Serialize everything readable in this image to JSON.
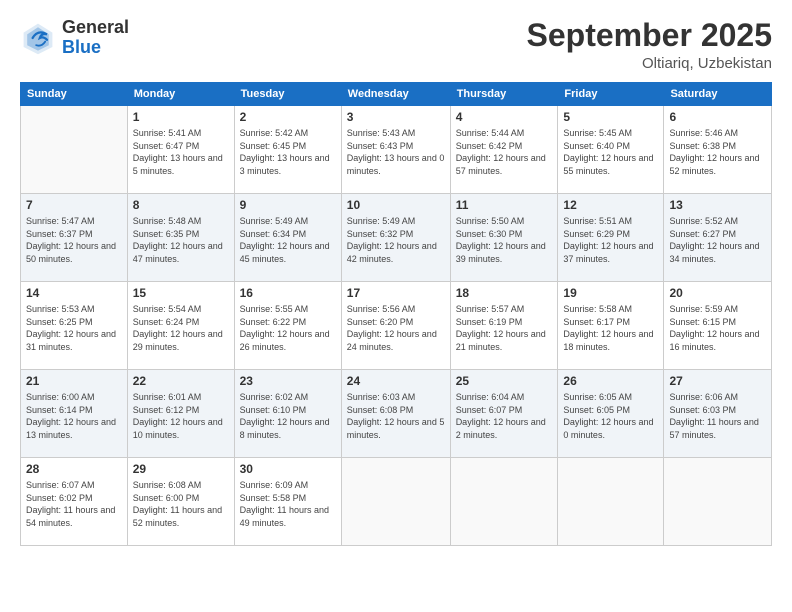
{
  "logo": {
    "general": "General",
    "blue": "Blue"
  },
  "header": {
    "month": "September 2025",
    "location": "Oltiariq, Uzbekistan"
  },
  "weekdays": [
    "Sunday",
    "Monday",
    "Tuesday",
    "Wednesday",
    "Thursday",
    "Friday",
    "Saturday"
  ],
  "weeks": [
    [
      {
        "day": "",
        "sunrise": "",
        "sunset": "",
        "daylight": ""
      },
      {
        "day": "1",
        "sunrise": "Sunrise: 5:41 AM",
        "sunset": "Sunset: 6:47 PM",
        "daylight": "Daylight: 13 hours and 5 minutes."
      },
      {
        "day": "2",
        "sunrise": "Sunrise: 5:42 AM",
        "sunset": "Sunset: 6:45 PM",
        "daylight": "Daylight: 13 hours and 3 minutes."
      },
      {
        "day": "3",
        "sunrise": "Sunrise: 5:43 AM",
        "sunset": "Sunset: 6:43 PM",
        "daylight": "Daylight: 13 hours and 0 minutes."
      },
      {
        "day": "4",
        "sunrise": "Sunrise: 5:44 AM",
        "sunset": "Sunset: 6:42 PM",
        "daylight": "Daylight: 12 hours and 57 minutes."
      },
      {
        "day": "5",
        "sunrise": "Sunrise: 5:45 AM",
        "sunset": "Sunset: 6:40 PM",
        "daylight": "Daylight: 12 hours and 55 minutes."
      },
      {
        "day": "6",
        "sunrise": "Sunrise: 5:46 AM",
        "sunset": "Sunset: 6:38 PM",
        "daylight": "Daylight: 12 hours and 52 minutes."
      }
    ],
    [
      {
        "day": "7",
        "sunrise": "Sunrise: 5:47 AM",
        "sunset": "Sunset: 6:37 PM",
        "daylight": "Daylight: 12 hours and 50 minutes."
      },
      {
        "day": "8",
        "sunrise": "Sunrise: 5:48 AM",
        "sunset": "Sunset: 6:35 PM",
        "daylight": "Daylight: 12 hours and 47 minutes."
      },
      {
        "day": "9",
        "sunrise": "Sunrise: 5:49 AM",
        "sunset": "Sunset: 6:34 PM",
        "daylight": "Daylight: 12 hours and 45 minutes."
      },
      {
        "day": "10",
        "sunrise": "Sunrise: 5:49 AM",
        "sunset": "Sunset: 6:32 PM",
        "daylight": "Daylight: 12 hours and 42 minutes."
      },
      {
        "day": "11",
        "sunrise": "Sunrise: 5:50 AM",
        "sunset": "Sunset: 6:30 PM",
        "daylight": "Daylight: 12 hours and 39 minutes."
      },
      {
        "day": "12",
        "sunrise": "Sunrise: 5:51 AM",
        "sunset": "Sunset: 6:29 PM",
        "daylight": "Daylight: 12 hours and 37 minutes."
      },
      {
        "day": "13",
        "sunrise": "Sunrise: 5:52 AM",
        "sunset": "Sunset: 6:27 PM",
        "daylight": "Daylight: 12 hours and 34 minutes."
      }
    ],
    [
      {
        "day": "14",
        "sunrise": "Sunrise: 5:53 AM",
        "sunset": "Sunset: 6:25 PM",
        "daylight": "Daylight: 12 hours and 31 minutes."
      },
      {
        "day": "15",
        "sunrise": "Sunrise: 5:54 AM",
        "sunset": "Sunset: 6:24 PM",
        "daylight": "Daylight: 12 hours and 29 minutes."
      },
      {
        "day": "16",
        "sunrise": "Sunrise: 5:55 AM",
        "sunset": "Sunset: 6:22 PM",
        "daylight": "Daylight: 12 hours and 26 minutes."
      },
      {
        "day": "17",
        "sunrise": "Sunrise: 5:56 AM",
        "sunset": "Sunset: 6:20 PM",
        "daylight": "Daylight: 12 hours and 24 minutes."
      },
      {
        "day": "18",
        "sunrise": "Sunrise: 5:57 AM",
        "sunset": "Sunset: 6:19 PM",
        "daylight": "Daylight: 12 hours and 21 minutes."
      },
      {
        "day": "19",
        "sunrise": "Sunrise: 5:58 AM",
        "sunset": "Sunset: 6:17 PM",
        "daylight": "Daylight: 12 hours and 18 minutes."
      },
      {
        "day": "20",
        "sunrise": "Sunrise: 5:59 AM",
        "sunset": "Sunset: 6:15 PM",
        "daylight": "Daylight: 12 hours and 16 minutes."
      }
    ],
    [
      {
        "day": "21",
        "sunrise": "Sunrise: 6:00 AM",
        "sunset": "Sunset: 6:14 PM",
        "daylight": "Daylight: 12 hours and 13 minutes."
      },
      {
        "day": "22",
        "sunrise": "Sunrise: 6:01 AM",
        "sunset": "Sunset: 6:12 PM",
        "daylight": "Daylight: 12 hours and 10 minutes."
      },
      {
        "day": "23",
        "sunrise": "Sunrise: 6:02 AM",
        "sunset": "Sunset: 6:10 PM",
        "daylight": "Daylight: 12 hours and 8 minutes."
      },
      {
        "day": "24",
        "sunrise": "Sunrise: 6:03 AM",
        "sunset": "Sunset: 6:08 PM",
        "daylight": "Daylight: 12 hours and 5 minutes."
      },
      {
        "day": "25",
        "sunrise": "Sunrise: 6:04 AM",
        "sunset": "Sunset: 6:07 PM",
        "daylight": "Daylight: 12 hours and 2 minutes."
      },
      {
        "day": "26",
        "sunrise": "Sunrise: 6:05 AM",
        "sunset": "Sunset: 6:05 PM",
        "daylight": "Daylight: 12 hours and 0 minutes."
      },
      {
        "day": "27",
        "sunrise": "Sunrise: 6:06 AM",
        "sunset": "Sunset: 6:03 PM",
        "daylight": "Daylight: 11 hours and 57 minutes."
      }
    ],
    [
      {
        "day": "28",
        "sunrise": "Sunrise: 6:07 AM",
        "sunset": "Sunset: 6:02 PM",
        "daylight": "Daylight: 11 hours and 54 minutes."
      },
      {
        "day": "29",
        "sunrise": "Sunrise: 6:08 AM",
        "sunset": "Sunset: 6:00 PM",
        "daylight": "Daylight: 11 hours and 52 minutes."
      },
      {
        "day": "30",
        "sunrise": "Sunrise: 6:09 AM",
        "sunset": "Sunset: 5:58 PM",
        "daylight": "Daylight: 11 hours and 49 minutes."
      },
      {
        "day": "",
        "sunrise": "",
        "sunset": "",
        "daylight": ""
      },
      {
        "day": "",
        "sunrise": "",
        "sunset": "",
        "daylight": ""
      },
      {
        "day": "",
        "sunrise": "",
        "sunset": "",
        "daylight": ""
      },
      {
        "day": "",
        "sunrise": "",
        "sunset": "",
        "daylight": ""
      }
    ]
  ]
}
